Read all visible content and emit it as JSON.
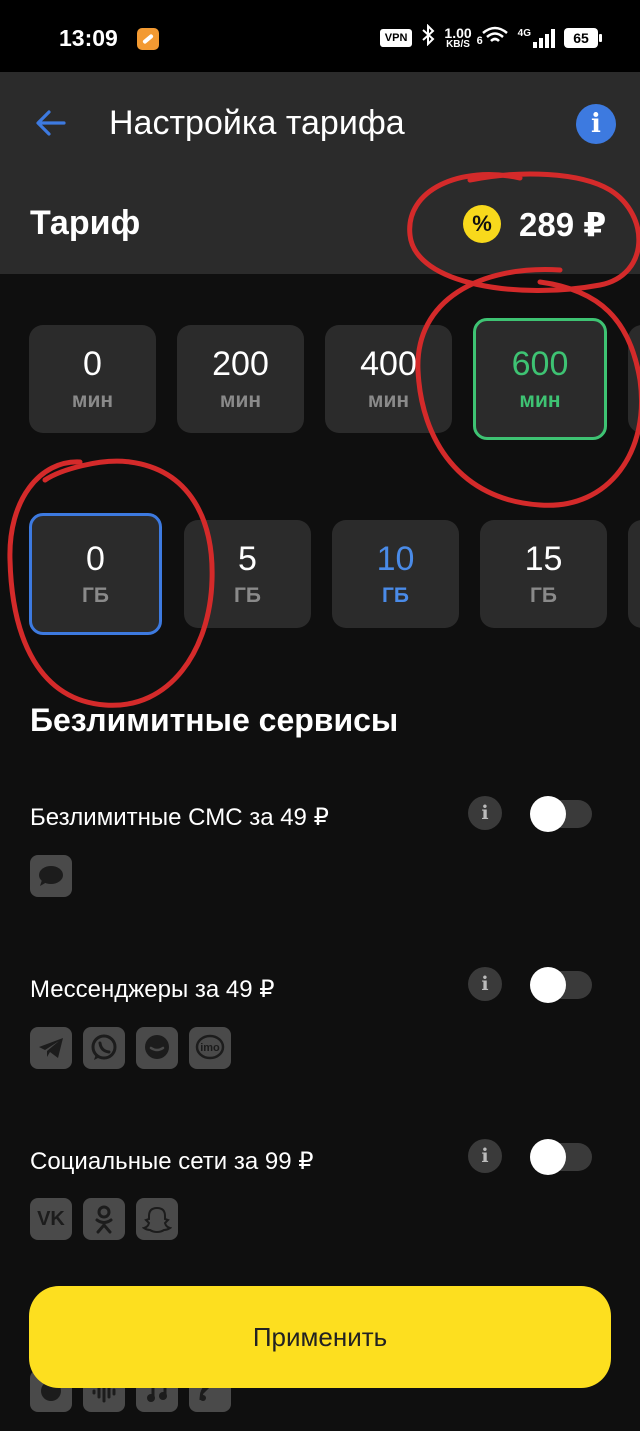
{
  "status_bar": {
    "time": "13:09",
    "vpn": "VPN",
    "speed_value": "1.00",
    "speed_unit": "KB/S",
    "battery": "65",
    "network": "4G",
    "wifi_label": "6"
  },
  "header": {
    "title": "Настройка тарифа"
  },
  "tariff": {
    "label": "Тариф",
    "discount_icon": "%",
    "price": "289 ₽"
  },
  "minutes": [
    {
      "value": "0",
      "unit": "мин"
    },
    {
      "value": "200",
      "unit": "мин"
    },
    {
      "value": "400",
      "unit": "мин"
    },
    {
      "value": "600",
      "unit": "мин"
    }
  ],
  "gigabytes": [
    {
      "value": "0",
      "unit": "ГБ"
    },
    {
      "value": "5",
      "unit": "ГБ"
    },
    {
      "value": "10",
      "unit": "ГБ"
    },
    {
      "value": "15",
      "unit": "ГБ"
    }
  ],
  "services": {
    "title": "Безлимитные сервисы",
    "items": [
      {
        "label": "Безлимитные СМС за 49 ₽",
        "icons": [
          "sms-icon"
        ]
      },
      {
        "label": "Мессенджеры за 49 ₽",
        "icons": [
          "telegram-icon",
          "whatsapp-icon",
          "tamtam-icon",
          "imo-icon"
        ],
        "imo": "imo"
      },
      {
        "label": "Социальные сети за 99 ₽",
        "icons": [
          "vk-icon",
          "odnoklassniki-icon",
          "snapchat-icon"
        ],
        "vk": "VK"
      }
    ],
    "info_glyph": "i"
  },
  "apply_label": "Применить",
  "colors": {
    "accent_yellow": "#fddf1f",
    "accent_green": "#3ec373",
    "accent_blue": "#3d7ae0",
    "annotation_red": "#d42a2a"
  }
}
